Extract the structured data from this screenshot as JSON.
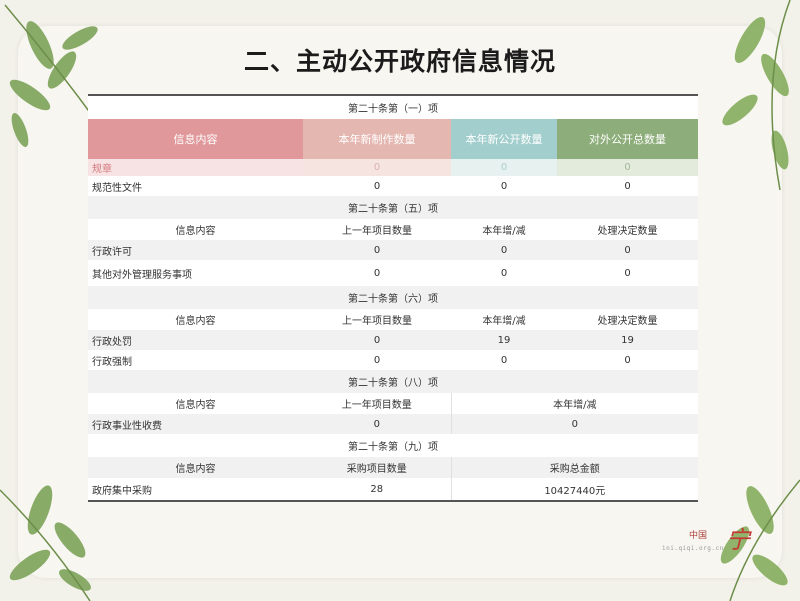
{
  "title": "二、主动公开政府信息情况",
  "sections": {
    "s20_1": {
      "heading": "第二十条第（一）项",
      "headers": [
        "信息内容",
        "本年新制作数量",
        "本年新公开数量",
        "对外公开总数量"
      ],
      "rows": [
        [
          "规章",
          "0",
          "0",
          "0"
        ],
        [
          "规范性文件",
          "0",
          "0",
          "0"
        ]
      ]
    },
    "s20_5": {
      "heading": "第二十条第（五）项",
      "headers": [
        "信息内容",
        "上一年项目数量",
        "本年增/减",
        "处理决定数量"
      ],
      "rows": [
        [
          "行政许可",
          "0",
          "0",
          "0"
        ],
        [
          "其他对外管理服务事项",
          "0",
          "0",
          "0"
        ]
      ]
    },
    "s20_6": {
      "heading": "第二十条第（六）项",
      "headers": [
        "信息内容",
        "上一年项目数量",
        "本年增/减",
        "处理决定数量"
      ],
      "rows": [
        [
          "行政处罚",
          "0",
          "19",
          "19"
        ],
        [
          "行政强制",
          "0",
          "0",
          "0"
        ]
      ]
    },
    "s20_8": {
      "heading": "第二十条第（八）项",
      "headers": [
        "信息内容",
        "上一年项目数量",
        "本年增/减"
      ],
      "rows": [
        [
          "行政事业性收费",
          "0",
          "0"
        ]
      ]
    },
    "s20_9": {
      "heading": "第二十条第（九）项",
      "headers": [
        "信息内容",
        "采购项目数量",
        "采购总金额"
      ],
      "rows": [
        [
          "政府集中采购",
          "28",
          "10427440元"
        ]
      ]
    }
  },
  "watermark": {
    "brand": "中国",
    "logo_char": "宁",
    "site": "ini.qiqi.org.cn"
  },
  "colors": {
    "header_pink": "#e0989b",
    "header_peach": "#e4b7b0",
    "header_teal": "#a2cfcd",
    "header_green": "#8dad7a"
  }
}
